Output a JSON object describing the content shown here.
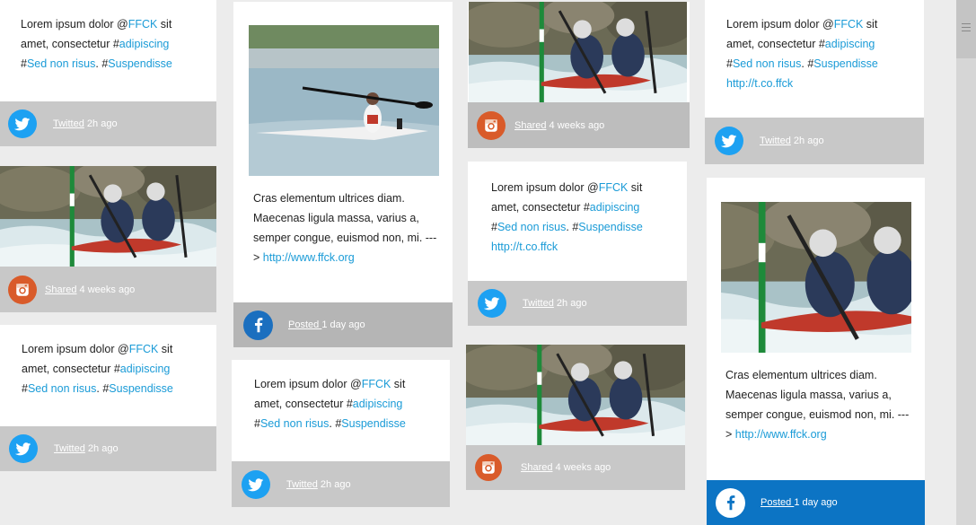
{
  "colors": {
    "accent": "#1a9bd7",
    "twitter": "#1da1f2",
    "instagram": "#d95b2a",
    "facebook": "#1b6fbf",
    "facebook_active": "#0c74c4",
    "footer_grey": "#c8c8c8"
  },
  "tweet": {
    "p1": "Lorem ipsum dolor @",
    "mention": "FFCK",
    "p2": " sit amet, consectetur #",
    "tag1": "adipiscing",
    "p3": "#",
    "tag2": "Sed non risus",
    "p4": ". #",
    "tag3": "Suspendisse",
    "link": "http://t.co.ffck"
  },
  "post": {
    "text": "Cras elementum ultrices diam. Maecenas ligula massa, varius a, semper congue, euismod non, mi. ---> ",
    "link": "http://www.ffck.org"
  },
  "meta": {
    "twitted": "Twitted",
    "twitted_time": " 2h ago",
    "shared": "Shared",
    "shared_time": " 4 weeks ago",
    "posted": "Posted ",
    "posted_time": " 1 day ago"
  },
  "icons": {
    "twitter": "twitter-icon",
    "instagram": "instagram-icon",
    "facebook": "facebook-icon"
  }
}
